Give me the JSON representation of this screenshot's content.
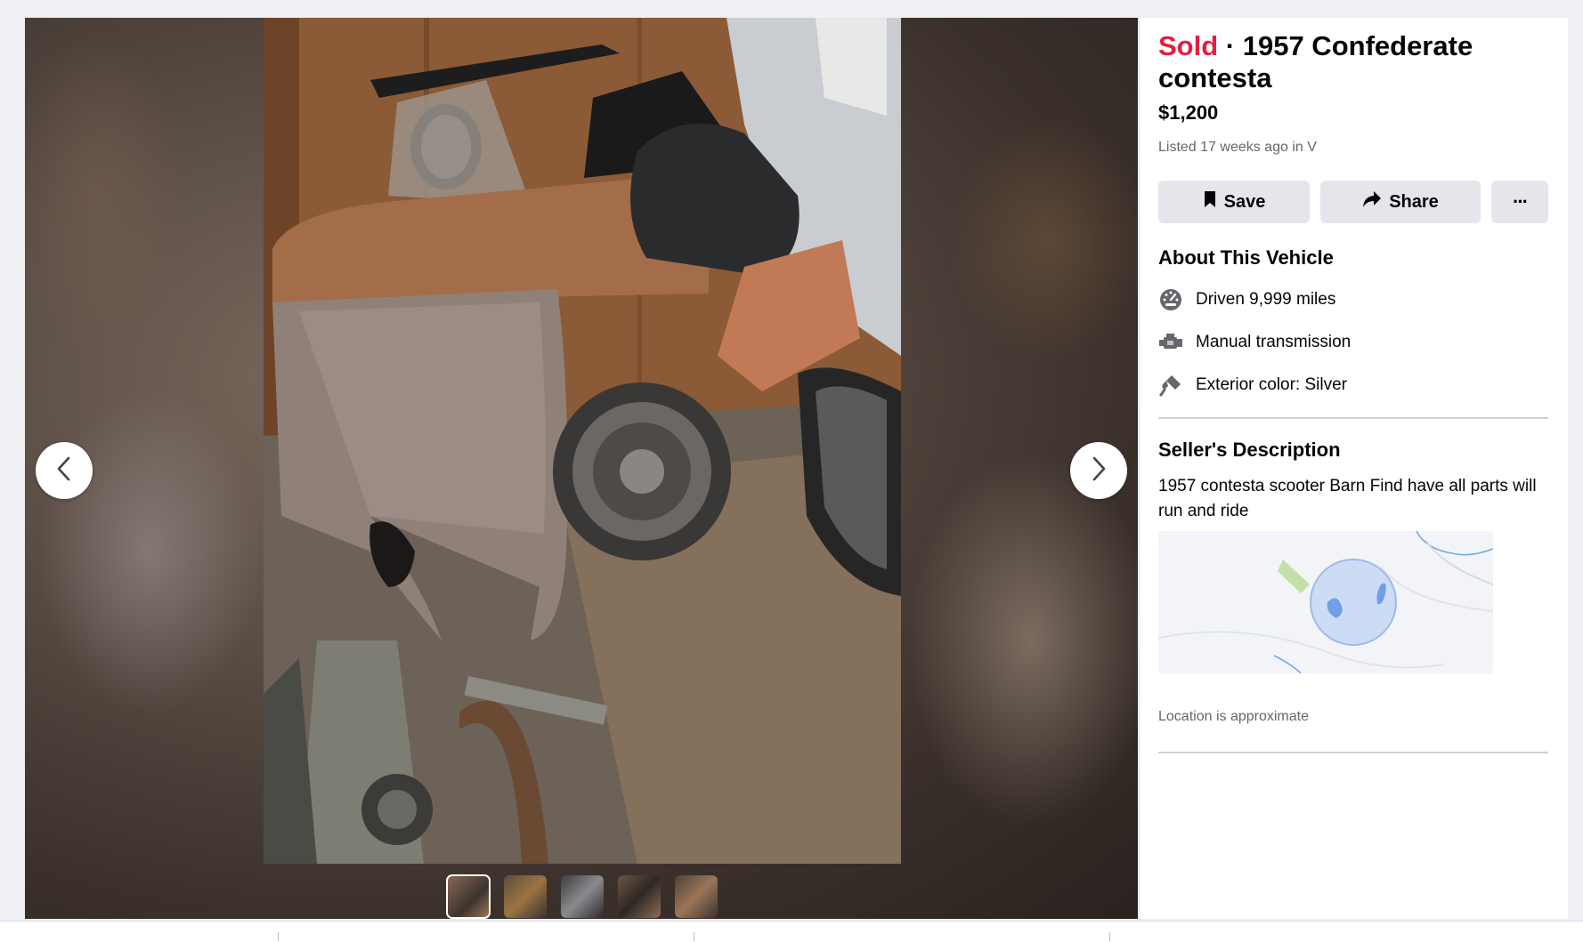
{
  "listing": {
    "status": "Sold",
    "separator": " · ",
    "title": "1957 Confederate contesta",
    "price": "$1,200",
    "listed": "Listed 17 weeks ago in V"
  },
  "actions": {
    "save_label": "Save",
    "share_label": "Share",
    "more_label": "···"
  },
  "about": {
    "heading": "About This Vehicle",
    "items": [
      {
        "icon": "speedometer-icon",
        "text": "Driven 9,999 miles"
      },
      {
        "icon": "engine-icon",
        "text": "Manual transmission"
      },
      {
        "icon": "paint-brush-icon",
        "text": "Exterior color: Silver"
      }
    ]
  },
  "description": {
    "heading": "Seller's Description",
    "text": "1957 contesta scooter Barn Find have all parts will run and ride"
  },
  "map": {
    "note": "Location is approximate"
  },
  "gallery": {
    "thumb_count": 5,
    "active_index": 0
  },
  "colors": {
    "sold": "#e41e3f",
    "button_bg": "#e4e6eb",
    "muted_text": "#65676b",
    "map_circle": "#c6d8f5",
    "map_water": "#7aa7e8"
  }
}
